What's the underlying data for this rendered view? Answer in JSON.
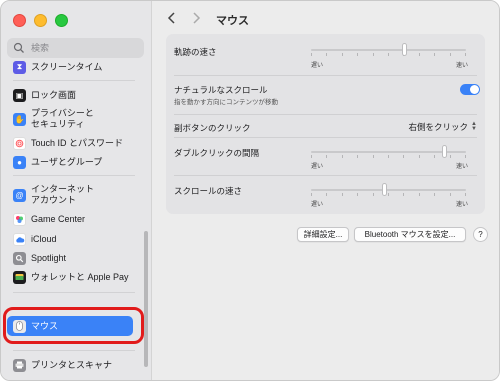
{
  "sidebar": {
    "search_placeholder": "検索",
    "items": [
      {
        "label": "スクリーンタイム",
        "icon": "hourglass-icon",
        "color": "#5e5ce6"
      },
      {
        "label": "ロック画面",
        "icon": "lock-screen-icon",
        "color": "#1c1c1e"
      },
      {
        "label": "プライバシーと\nセキュリティ",
        "icon": "hand-icon",
        "color": "#3a82f7"
      },
      {
        "label": "Touch ID とパスワード",
        "icon": "fingerprint-icon",
        "color": "#ff6b6b"
      },
      {
        "label": "ユーザとグループ",
        "icon": "users-icon",
        "color": "#3a82f7"
      },
      {
        "label": "インターネット\nアカウント",
        "icon": "at-icon",
        "color": "#3a82f7"
      },
      {
        "label": "Game Center",
        "icon": "game-center-icon",
        "color": "#ffffff"
      },
      {
        "label": "iCloud",
        "icon": "icloud-icon",
        "color": "#ffffff"
      },
      {
        "label": "Spotlight",
        "icon": "spotlight-icon",
        "color": "#8e8e93"
      },
      {
        "label": "ウォレットと Apple Pay",
        "icon": "wallet-icon",
        "color": "#1c1c1e"
      },
      {
        "label": "マウス",
        "icon": "mouse-icon",
        "color": "#8e8e93"
      },
      {
        "label": "プリンタとスキャナ",
        "icon": "printer-icon",
        "color": "#8e8e93"
      }
    ],
    "selected": "マウス"
  },
  "main": {
    "title": "マウス",
    "tracking": {
      "label": "軌跡の速さ",
      "min_label": "遅い",
      "max_label": "速い",
      "value": 0.6
    },
    "natural": {
      "label": "ナチュラルなスクロール",
      "sub": "指を動かす方向にコンテンツが移動",
      "on": true
    },
    "secondary": {
      "label": "副ボタンのクリック",
      "value": "右側をクリック"
    },
    "double_click": {
      "label": "ダブルクリックの間隔",
      "min_label": "遅い",
      "max_label": "速い",
      "value": 0.86
    },
    "scroll_speed": {
      "label": "スクロールの速さ",
      "min_label": "遅い",
      "max_label": "速い",
      "value": 0.47
    }
  },
  "buttons": {
    "advanced": "詳細設定...",
    "bluetooth": "Bluetooth マウスを設定...",
    "help": "?"
  },
  "colors": {
    "accent": "#3a82f7",
    "highlight": "#e11b1b"
  }
}
